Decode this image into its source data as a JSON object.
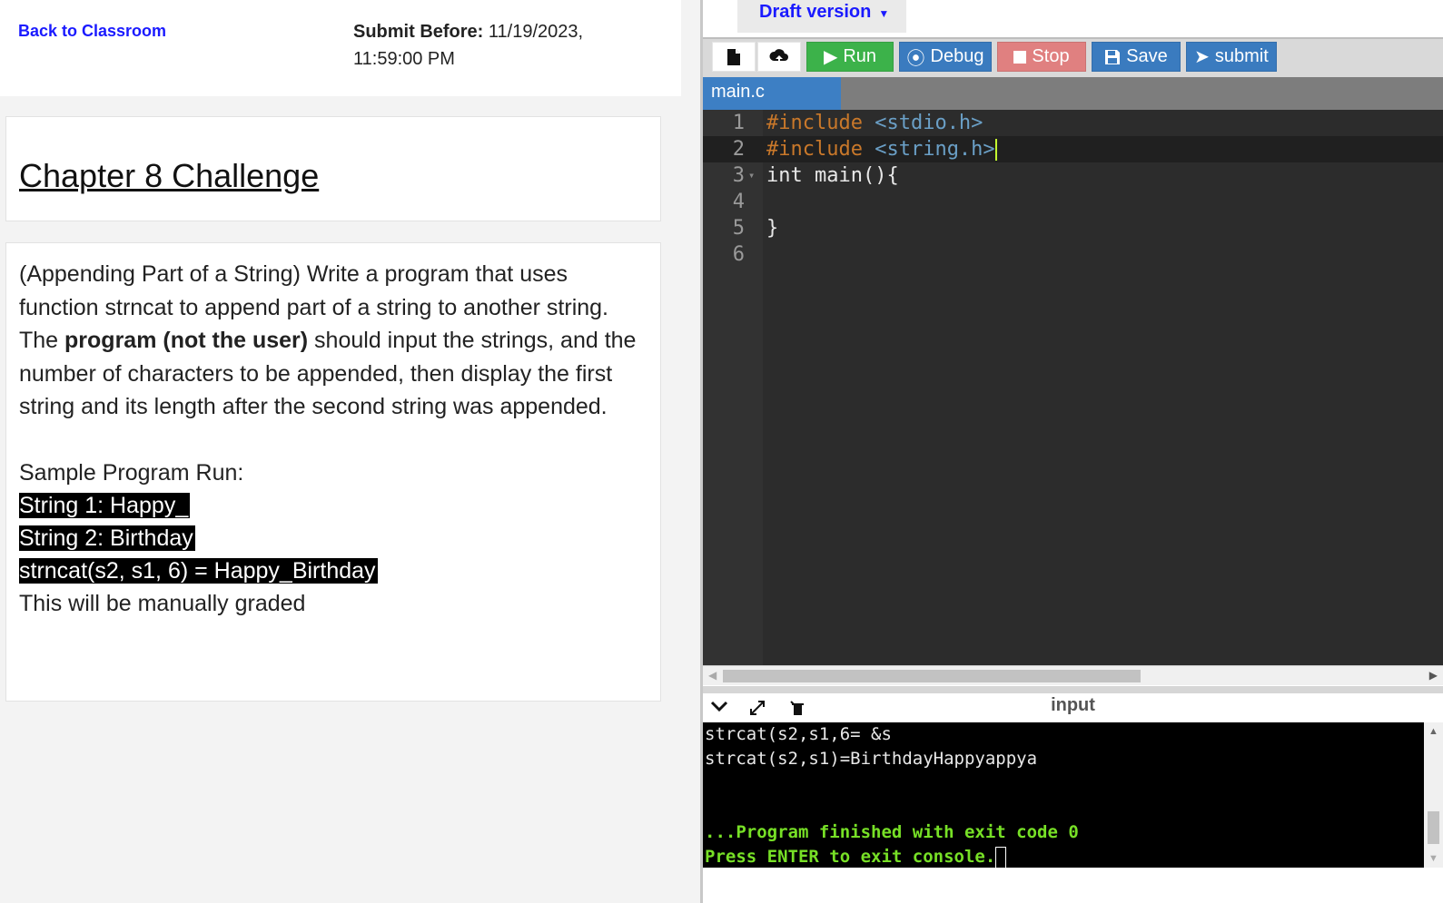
{
  "header": {
    "back_link": "Back to Classroom",
    "submit_before_label": "Submit Before:",
    "submit_before_value": "11/19/2023, 11:59:00 PM"
  },
  "assignment": {
    "title": "Chapter 8 Challenge",
    "desc_part1": "(Appending Part of a String) Write a program that uses function strncat to append part of a string to another string. The ",
    "desc_bold": "program (not the user)",
    "desc_part2": " should input the strings, and the number of characters to be appended, then display the first string and its length after the second string was appended.",
    "sample_heading": "Sample Program Run:",
    "sample_lines": [
      "String 1: Happy_",
      "String 2: Birthday",
      "strncat(s2, s1, 6) = Happy_Birthday"
    ],
    "grading_note": "This will be manually graded"
  },
  "editor_panel": {
    "version_label": "Draft version",
    "toolbar": {
      "new_file_icon": "file-icon",
      "upload_icon": "cloud-upload-icon",
      "run": "Run",
      "debug": "Debug",
      "stop": "Stop",
      "save": "Save",
      "submit": "submit"
    },
    "tab_name": "main.c",
    "line_numbers": [
      "1",
      "2",
      "3",
      "4",
      "5",
      "6"
    ],
    "code": {
      "l1_directive": "#include",
      "l1_header": "<stdio.h>",
      "l2_directive": "#include",
      "l2_header": "<string.h>",
      "l3": "int main(){",
      "l4": "",
      "l5": "}",
      "l6": ""
    },
    "console": {
      "title": "input",
      "lines": [
        "strcat(s2,s1,6= &s",
        "strcat(s2,s1)=BirthdayHappyappya",
        "",
        "",
        "...Program finished with exit code 0",
        "Press ENTER to exit console."
      ]
    },
    "colors": {
      "run": "#3cb24a",
      "debug": "#3a7bbf",
      "stop": "#e08080",
      "console_green": "#77e026"
    }
  }
}
